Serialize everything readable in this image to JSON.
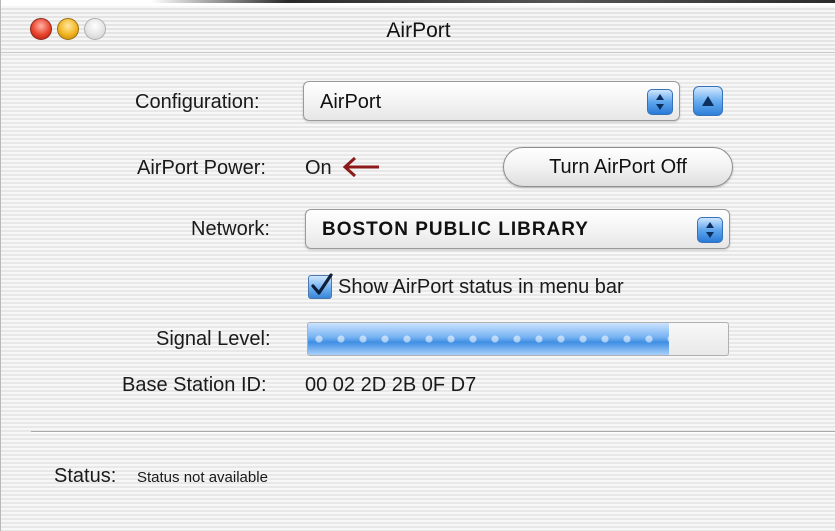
{
  "window": {
    "title": "AirPort",
    "accent_color": "#3a86d8"
  },
  "configuration": {
    "label": "Configuration:",
    "value": "AirPort"
  },
  "power": {
    "label": "AirPort Power:",
    "value": "On",
    "annotation_arrow_color": "#8b1a1a",
    "toggle_button_label": "Turn AirPort Off"
  },
  "network": {
    "label": "Network:",
    "value": "BOSTON PUBLIC LIBRARY"
  },
  "menu_bar_status": {
    "label": "Show AirPort status in menu bar",
    "checked": true
  },
  "signal": {
    "label": "Signal Level:",
    "level_percent": 86
  },
  "base_station": {
    "label": "Base Station ID:",
    "value": "00 02 2D 2B 0F D7"
  },
  "status": {
    "label": "Status:",
    "value": "Status not available"
  }
}
